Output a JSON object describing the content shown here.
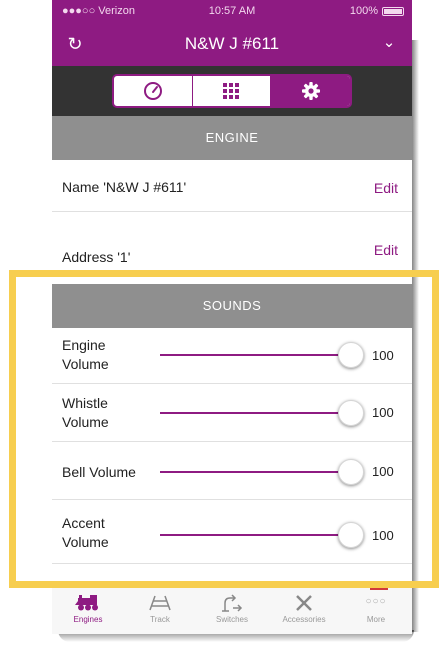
{
  "status_bar": {
    "carrier": "●●●○○ Verizon",
    "time": "10:57 AM",
    "battery": "100%"
  },
  "nav": {
    "title": "N&W J #611",
    "refresh_icon": "refresh-icon",
    "chevron_icon": "chevron-down-icon"
  },
  "segments": [
    {
      "name": "speedometer-icon",
      "selected": false
    },
    {
      "name": "keypad-grid-icon",
      "selected": false
    },
    {
      "name": "gear-icon",
      "selected": true
    }
  ],
  "engine_section": {
    "header": "ENGINE",
    "name_row": {
      "label": "Name 'N&W J #611'",
      "action": "Edit"
    },
    "address_row": {
      "label": "Address '1'",
      "action": "Edit"
    }
  },
  "sounds_section": {
    "header": "SOUNDS",
    "sliders": [
      {
        "label": "Engine Volume",
        "value": "100"
      },
      {
        "label": "Whistle Volume",
        "value": "100"
      },
      {
        "label": "Bell Volume",
        "value": "100"
      },
      {
        "label": "Accent Volume",
        "value": "100"
      }
    ]
  },
  "tabbar": [
    {
      "label": "Engines",
      "icon": "locomotive-icon",
      "active": true
    },
    {
      "label": "Track",
      "icon": "track-icon",
      "active": false
    },
    {
      "label": "Switches",
      "icon": "switch-icon",
      "active": false
    },
    {
      "label": "Accessories",
      "icon": "crossing-icon",
      "active": false
    },
    {
      "label": "More",
      "icon": "more-dots-icon",
      "active": false
    }
  ],
  "colors": {
    "accent": "#8e1b82",
    "header_gray": "#8f8f8f",
    "highlight": "#f7ce4f",
    "segment_bar": "#333333"
  }
}
